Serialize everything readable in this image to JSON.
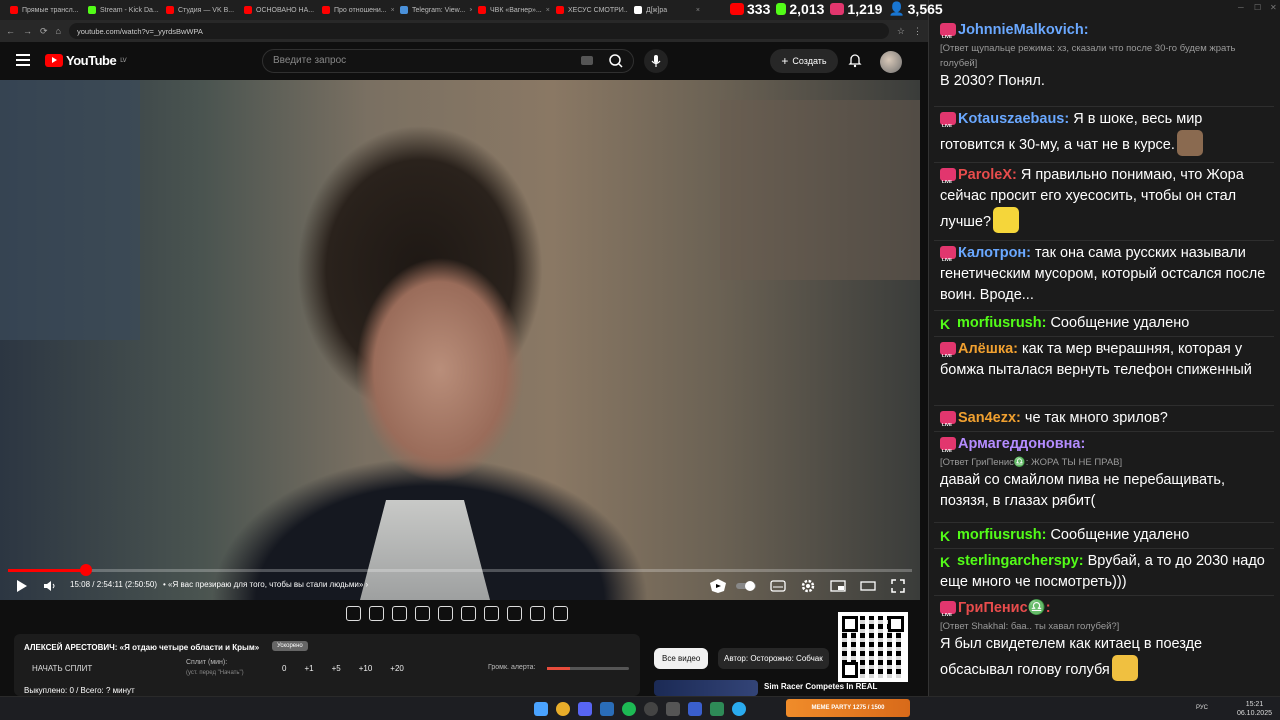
{
  "browser": {
    "tabs": [
      {
        "label": "Прямые трансл...",
        "color": "#ff0000"
      },
      {
        "label": "Stream - Kick Da...",
        "color": "#53fc18"
      },
      {
        "label": "Студия — VK В...",
        "color": "#ff0000"
      },
      {
        "label": "ОСНОВАНО НА...",
        "color": "#ff0000"
      },
      {
        "label": "Про отношени...",
        "color": "#ff0000"
      },
      {
        "label": "Telegram: View...",
        "color": "#4a90d9"
      },
      {
        "label": "ЧВК «Вагнер»...",
        "color": "#ff0000"
      },
      {
        "label": "ХЕСУС СМОТРИ...",
        "color": "#ff0000"
      },
      {
        "label": "Д[ж]ра",
        "color": "#ffffff"
      }
    ],
    "url": "youtube.com/watch?v=_yyrdsBwWPA"
  },
  "stream_stats": {
    "youtube_viewers": "333",
    "kick_viewers": "2,013",
    "vk_viewers": "1,219",
    "total_viewers": "3,565"
  },
  "youtube": {
    "logo_text": "YouTube",
    "logo_region": "LV",
    "search_placeholder": "Введите запрос",
    "create_label": "Создать"
  },
  "player": {
    "progress": 0.0866,
    "time": "15:08 / 2:54:11 (2:50:50)",
    "chapter": "• «Я вас презираю для того, чтобы вы стали людьми» ›"
  },
  "split_panel": {
    "title": "АЛЕКСЕЙ АРЕСТОВИЧ: «Я отдаю четыре области и Крым»",
    "tag": "Ускорено",
    "start_label": "НАЧАТЬ СПЛИТ",
    "split_label": "Сплит (мин):",
    "split_sub": "(уст. перед \"Начать\")",
    "value": "0",
    "steps": [
      "+1",
      "+5",
      "+10",
      "+20"
    ],
    "volume_label": "Громк. алерта:",
    "volume": 0.28,
    "footer": "Выкуплено: 0 / Всего: ? минут"
  },
  "chips": {
    "all": "Все видео",
    "author": "Автор: Осторожно: Собчак"
  },
  "recommendation": {
    "title": "Sim Racer Competes In REAL"
  },
  "chat": {
    "messages": [
      {
        "platform": "vk",
        "user": "JohnnieMalkovich:",
        "color": "#6aa8ff",
        "reply": "[Ответ щупальце режима: хз, сказали что после 30-го будем жрать голубей]",
        "text": "В 2030? Понял."
      },
      {
        "platform": "vk",
        "user": "Kotauszaebaus:",
        "color": "#6aa8ff",
        "text": "Я в шоке, весь мир готовится к 30-му, а чат не в курсе."
      },
      {
        "platform": "vk",
        "user": "ParoleX:",
        "color": "#e84c4c",
        "text": "Я правильно понимаю, что Жора сейчас просит его хуесосить, чтобы он стал лучше?"
      },
      {
        "platform": "vk",
        "user": "Калотрон:",
        "color": "#6aa8ff",
        "text": "так она сама русских называли генетическим мусором, который остсался после воин. Вроде..."
      },
      {
        "platform": "kick",
        "user": "morfiusrush:",
        "color": "#53fc18",
        "text": "Сообщение удалено"
      },
      {
        "platform": "vk",
        "user": "Алёшка:",
        "color": "#f0a030",
        "text": "как та мер вчерашняя, которая у бомжа пыталася вернуть телефон спиженный"
      },
      {
        "platform": "vk",
        "user": "San4ezx:",
        "color": "#f0a030",
        "text": "че так много зрилов?"
      },
      {
        "platform": "vk",
        "user": "Армагеддоновна:",
        "color": "#b48cff",
        "reply": "[Ответ ГриПенис♎: ЖОРА ТЫ НЕ ПРАВ]",
        "text": "давай со смайлом пива не перебащивать, позязя, в глазах рябит("
      },
      {
        "platform": "kick",
        "user": "morfiusrush:",
        "color": "#53fc18",
        "text": "Сообщение удалено"
      },
      {
        "platform": "kick",
        "user": "sterlingarchersрy:",
        "color": "#53fc18",
        "text": "Врубай, а то до 2030 надо еще много че посмотреть)))"
      },
      {
        "platform": "vk",
        "user": "ГриПенис♎:",
        "color": "#e84c4c",
        "reply": "[Ответ Shakhal: баа.. ты хавал голубей?]",
        "text": "Я был свидетелем как китаец в поезде обсасывал голову голубя"
      }
    ]
  },
  "taskbar": {
    "lang": "РУС",
    "time": "15:21",
    "date": "06.10.2025",
    "meme_label": "MEME PARTY",
    "meme_progress": "1275 / 1500"
  }
}
